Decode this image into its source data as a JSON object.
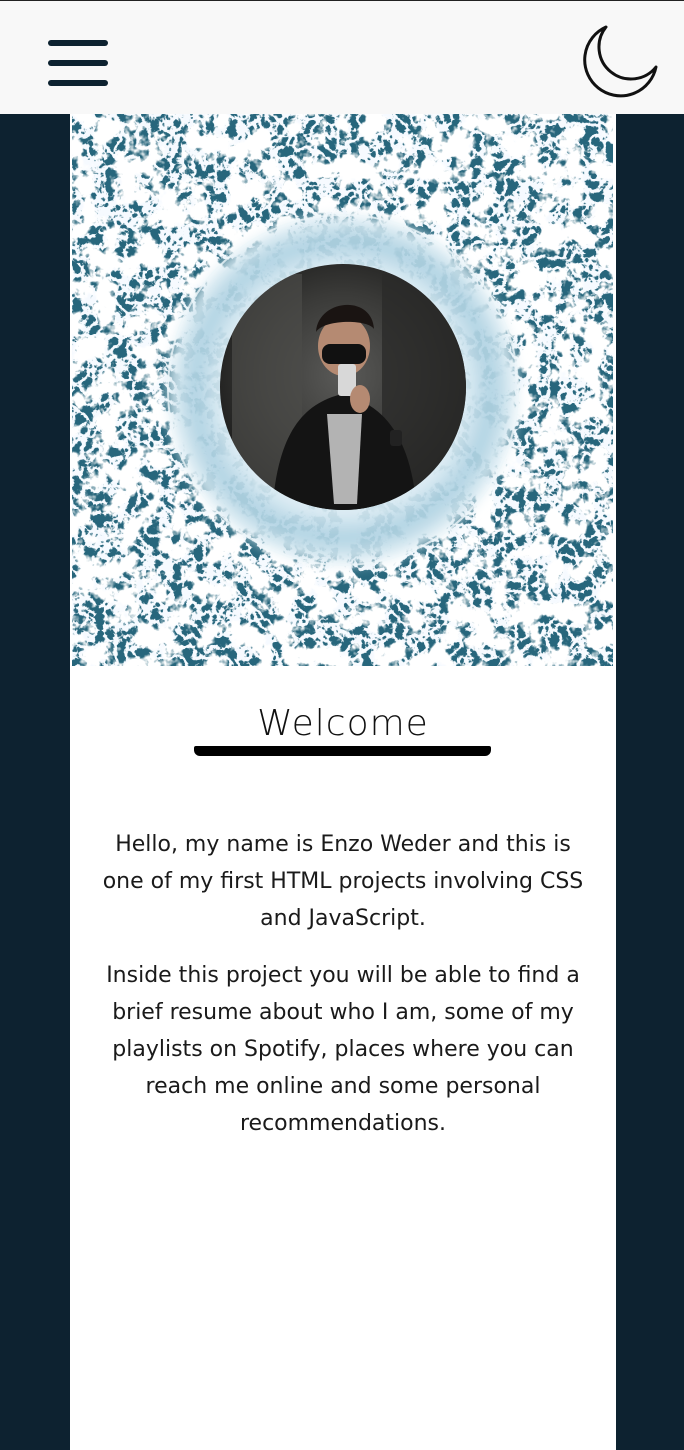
{
  "header": {
    "menu_icon": "hamburger-menu-icon",
    "theme_icon": "moon-icon"
  },
  "hero": {
    "background": "ocean-waves-image",
    "profile_photo": "profile-photo"
  },
  "welcome": {
    "title": "Welcome"
  },
  "intro": {
    "paragraph_1": "Hello, my name is Enzo Weder and this is one of my first HTML projects involving CSS and JavaScript.",
    "paragraph_2": "Inside this project you will be able to find a brief resume about who I am, some of my playlists on Spotify, places where you can reach me online and some personal recommendations."
  },
  "colors": {
    "background": "#0d2230",
    "header": "#f8f8f8",
    "content": "#ffffff",
    "text": "#1a1a1a"
  }
}
